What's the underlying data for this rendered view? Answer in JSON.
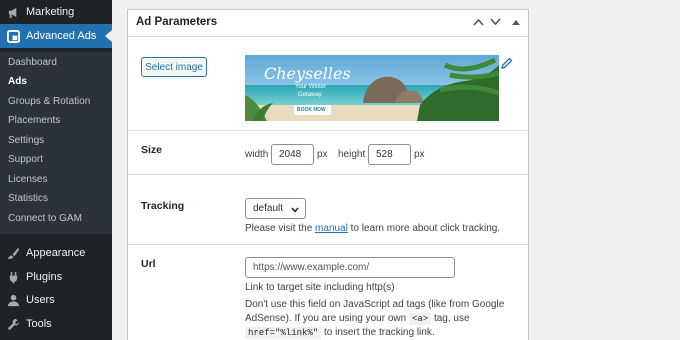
{
  "sidebar": {
    "marketing": "Marketing",
    "advanced_ads": "Advanced Ads",
    "submenu": [
      "Dashboard",
      "Ads",
      "Groups & Rotation",
      "Placements",
      "Settings",
      "Support",
      "Licenses",
      "Statistics",
      "Connect to GAM"
    ],
    "current": "Ads",
    "bottom": [
      "Appearance",
      "Plugins",
      "Users",
      "Tools"
    ]
  },
  "panel": {
    "title": "Ad Parameters",
    "select_image_label": "Select image",
    "banner": {
      "brand": "Cheyselles",
      "line1": "Your Winter",
      "line2": "Getaway",
      "cta": "BOOK NOW"
    },
    "size": {
      "label": "Size",
      "width_label": "width",
      "width_value": "2048",
      "height_label": "height",
      "height_value": "528",
      "unit": "px"
    },
    "tracking": {
      "label": "Tracking",
      "selected": "default",
      "help_before": "Please visit the ",
      "help_link": "manual",
      "help_after": " to learn more about click tracking."
    },
    "url": {
      "label": "Url",
      "placeholder": "https://www.example.com/",
      "help1": "Link to target site including http(s)",
      "help2_line1": "Don't use this field on JavaScript ad tags (like from Google",
      "help2_line2a": "AdSense). If you are using your own ",
      "code1": "<a>",
      "help2_line2b": " tag, use",
      "code2": "href=\"%link%\"",
      "help2_line3": " to insert the tracking link."
    }
  },
  "colors": {
    "admin_bar": "#1d2327",
    "accent": "#2271b1",
    "submenu_bg": "#2c3338"
  }
}
